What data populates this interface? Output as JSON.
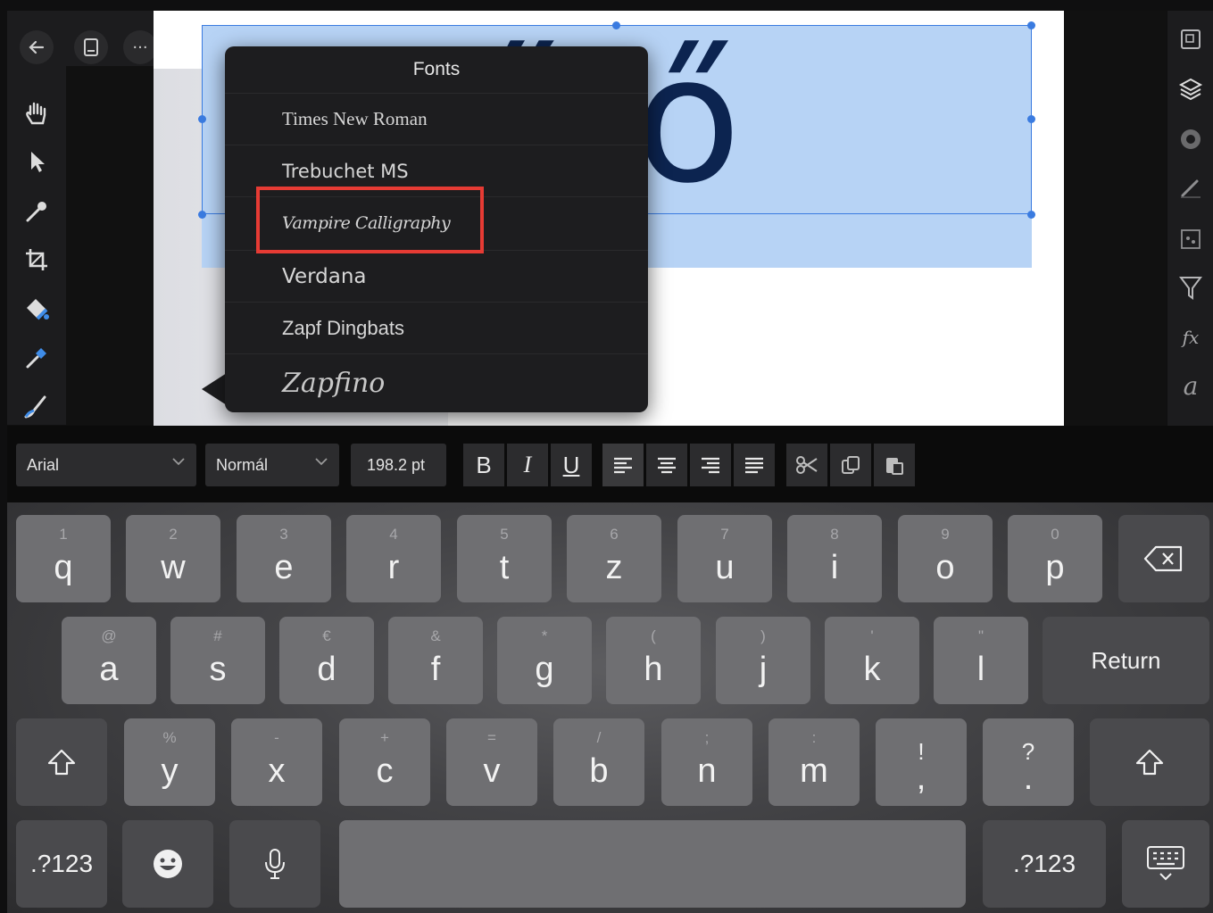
{
  "toolbar": {
    "icons": [
      "back-arrow-icon",
      "document-icon",
      "more-icon",
      "persona-icon",
      "ellipse-icon",
      "target-icon",
      "export-icon",
      "divider-icon"
    ],
    "more_label": "···"
  },
  "left_tools": [
    "hand-icon",
    "pointer-icon",
    "eyedropper-icon",
    "crop-icon",
    "fill-bucket-icon",
    "pen-icon",
    "brush-icon"
  ],
  "right_tools": [
    "canvas-icon",
    "layers-icon",
    "adjustments-icon",
    "brush-settings-icon",
    "channels-icon",
    "filter-icon",
    "fx-icon",
    "text-style-icon"
  ],
  "right_labels": {
    "fx": "fx",
    "text_style": "a"
  },
  "canvas": {
    "text": "ztűrő"
  },
  "font_popover": {
    "title": "Fonts",
    "items": [
      {
        "label": "Times New Roman"
      },
      {
        "label": "Trebuchet MS"
      },
      {
        "label": "Vampire Calligraphy"
      },
      {
        "label": "Verdana"
      },
      {
        "label": "Zapf Dingbats"
      },
      {
        "label": "Zapfino"
      }
    ],
    "highlighted": "Vampire Calligraphy"
  },
  "format_bar": {
    "font_name": "Arial",
    "font_style": "Normál",
    "font_size": "198.2 pt",
    "bold": "B",
    "italic": "I",
    "underline": "U"
  },
  "keyboard": {
    "row1": [
      {
        "alt": "1",
        "main": "q"
      },
      {
        "alt": "2",
        "main": "w"
      },
      {
        "alt": "3",
        "main": "e"
      },
      {
        "alt": "4",
        "main": "r"
      },
      {
        "alt": "5",
        "main": "t"
      },
      {
        "alt": "6",
        "main": "z"
      },
      {
        "alt": "7",
        "main": "u"
      },
      {
        "alt": "8",
        "main": "i"
      },
      {
        "alt": "9",
        "main": "o"
      },
      {
        "alt": "0",
        "main": "p"
      }
    ],
    "row2": [
      {
        "alt": "@",
        "main": "a"
      },
      {
        "alt": "#",
        "main": "s"
      },
      {
        "alt": "€",
        "main": "d"
      },
      {
        "alt": "&",
        "main": "f"
      },
      {
        "alt": "*",
        "main": "g"
      },
      {
        "alt": "(",
        "main": "h"
      },
      {
        "alt": ")",
        "main": "j"
      },
      {
        "alt": "'",
        "main": "k"
      },
      {
        "alt": "\"",
        "main": "l"
      }
    ],
    "row3": [
      {
        "alt": "%",
        "main": "y"
      },
      {
        "alt": "-",
        "main": "x"
      },
      {
        "alt": "+",
        "main": "c"
      },
      {
        "alt": "=",
        "main": "v"
      },
      {
        "alt": "/",
        "main": "b"
      },
      {
        "alt": ";",
        "main": "n"
      },
      {
        "alt": ":",
        "main": "m"
      },
      {
        "alt": "!",
        "main": ","
      },
      {
        "alt": "?",
        "main": "."
      }
    ],
    "return_label": "Return",
    "num_label": ".?123",
    "num_label_right": ".?123"
  },
  "colors": {
    "selection": "#b7d3f5",
    "canvas_text": "#0c2450",
    "highlight_border": "#e63b34"
  }
}
